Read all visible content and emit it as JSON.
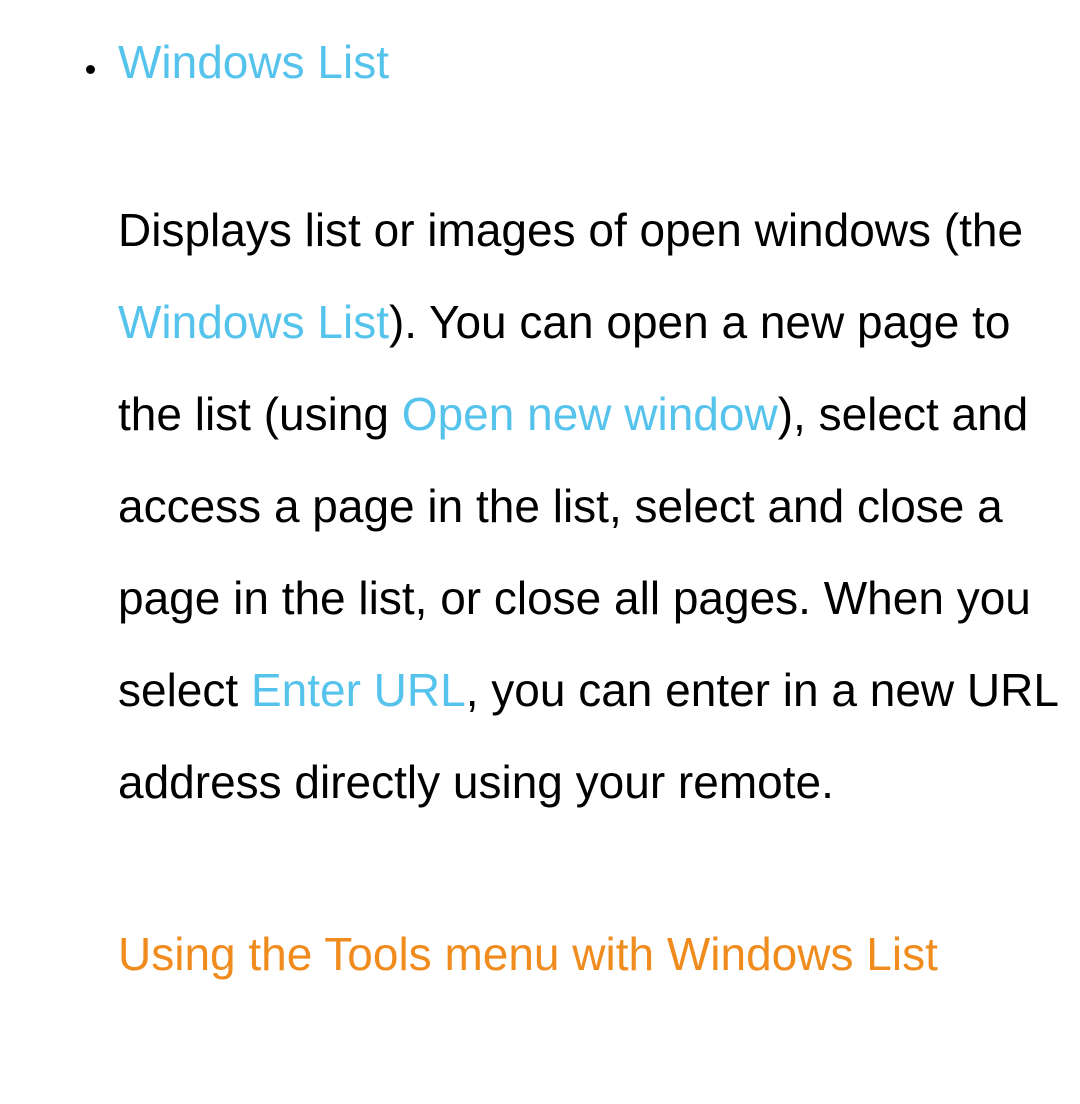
{
  "list": {
    "item0": {
      "title": "Windows List",
      "para": {
        "t0": "Displays list or images of open windows (the ",
        "link0": "Windows List",
        "t1": "). You can open a new page to the list (using ",
        "link1": "Open new window",
        "t2": "), select and access a page in the list, select and close a page in the list, or close all pages. When you select ",
        "link2": "Enter URL",
        "t3": ", you can enter in a new URL address directly using your remote."
      },
      "subheading": "Using the Tools menu with Windows List"
    }
  }
}
